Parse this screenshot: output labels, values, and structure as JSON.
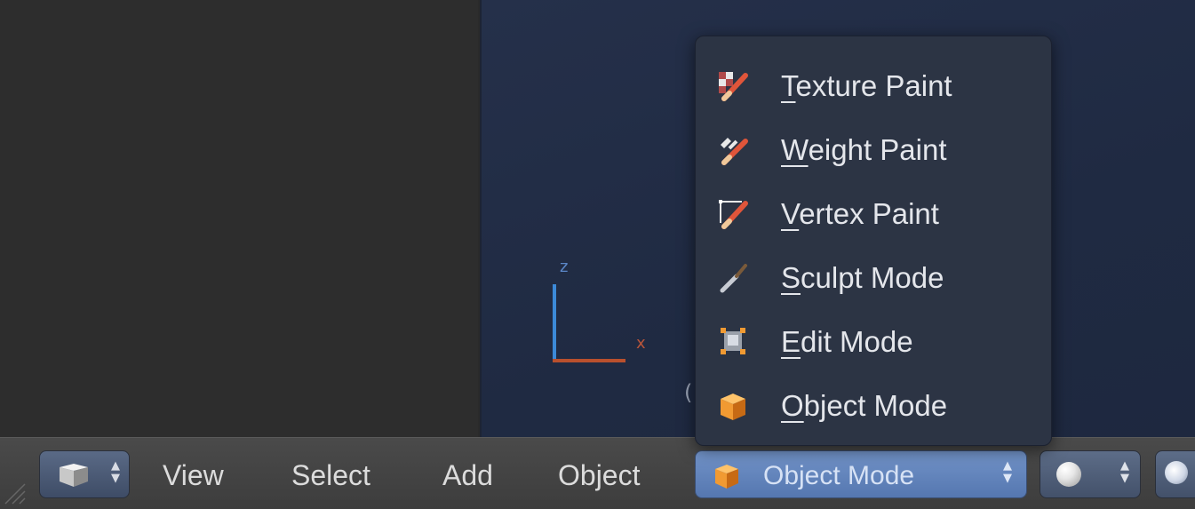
{
  "viewport": {
    "axis_z": "z",
    "axis_x": "x",
    "object_info": "(1"
  },
  "header": {
    "menu": [
      {
        "label": "View"
      },
      {
        "label": "Select"
      },
      {
        "label": "Add"
      },
      {
        "label": "Object"
      }
    ],
    "mode_selector": {
      "value": "Object Mode",
      "icon": "object-mode-cube-icon"
    },
    "editor_type_icon": "3d-view-cube-icon",
    "shading_icon": "solid-sphere-icon",
    "pivot_icon": "pivot-point-icon"
  },
  "mode_dropdown": {
    "items": [
      {
        "mnemonic": "T",
        "rest": "exture Paint",
        "icon": "texture-paint-icon"
      },
      {
        "mnemonic": "W",
        "rest": "eight Paint",
        "icon": "weight-paint-icon"
      },
      {
        "mnemonic": "V",
        "rest": "ertex Paint",
        "icon": "vertex-paint-icon"
      },
      {
        "mnemonic": "S",
        "rest": "culpt Mode",
        "icon": "sculpt-mode-icon"
      },
      {
        "mnemonic": "E",
        "rest": "dit Mode",
        "icon": "edit-mode-icon"
      },
      {
        "mnemonic": "O",
        "rest": "bject Mode",
        "icon": "object-mode-icon"
      }
    ]
  },
  "colors": {
    "viewport_bg": "#222d45",
    "menu_bg": "#2c3444",
    "mode_selector_bg": "#6385bc",
    "axis_z": "#3c8ad8",
    "axis_x": "#b9502d"
  }
}
